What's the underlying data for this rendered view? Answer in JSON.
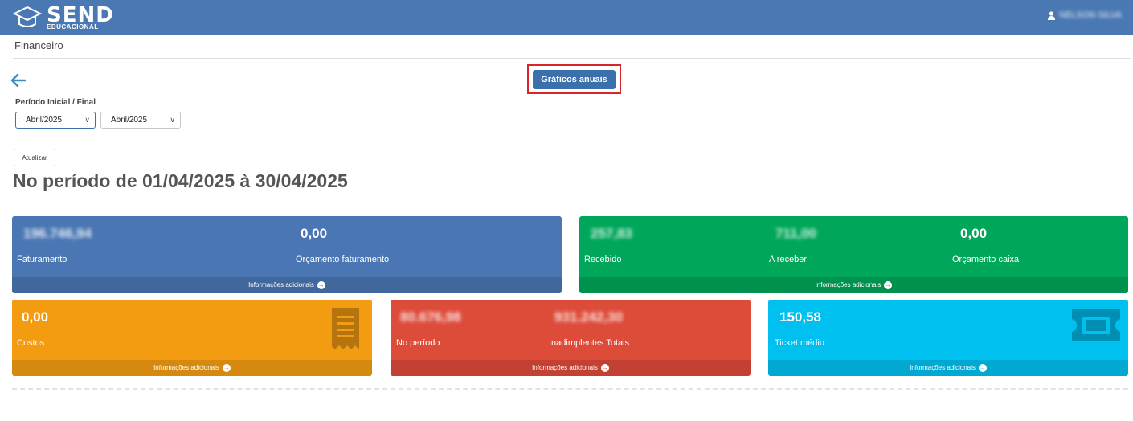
{
  "header": {
    "logo_big": "SEND",
    "logo_small": "EDUCACIONAL",
    "user_name": "NELSON SILVA"
  },
  "breadcrumb": "Financeiro",
  "graficos_label": "Gráficos anuais",
  "period": {
    "label": "Período Inicial / Final",
    "start": "Abril/2025",
    "end": "Abril/2025"
  },
  "atualizar_label": "Atualizar",
  "heading": "No período de 01/04/2025 à 30/04/2025",
  "footer_label": "Informações adicionais",
  "cards": {
    "faturamento": {
      "value": "196.746,94",
      "label": "Faturamento"
    },
    "orcamento_faturamento": {
      "value": "0,00",
      "label": "Orçamento faturamento"
    },
    "recebido": {
      "value": "257,83",
      "label": "Recebido"
    },
    "a_receber": {
      "value": "711,00",
      "label": "A receber"
    },
    "orcamento_caixa": {
      "value": "0,00",
      "label": "Orçamento caixa"
    },
    "custos": {
      "value": "0,00",
      "label": "Custos"
    },
    "no_periodo": {
      "value": "80.676,98",
      "label": "No período"
    },
    "inadimplentes": {
      "value": "931.242,30",
      "label": "Inadimplentes Totais"
    },
    "ticket": {
      "value": "150,58",
      "label": "Ticket médio"
    }
  },
  "colors": {
    "topbar": "#4a78b3",
    "blue": "#4a77b3",
    "green": "#00a65a",
    "orange": "#f39c12",
    "red": "#dd4b39",
    "cyan": "#00c0ef",
    "highlight": "#d9252a"
  },
  "icons": [
    "graduation-cap-icon",
    "user-icon",
    "back-arrow-icon",
    "receipt-icon",
    "ticket-icon",
    "arrow-circle-right-icon"
  ]
}
